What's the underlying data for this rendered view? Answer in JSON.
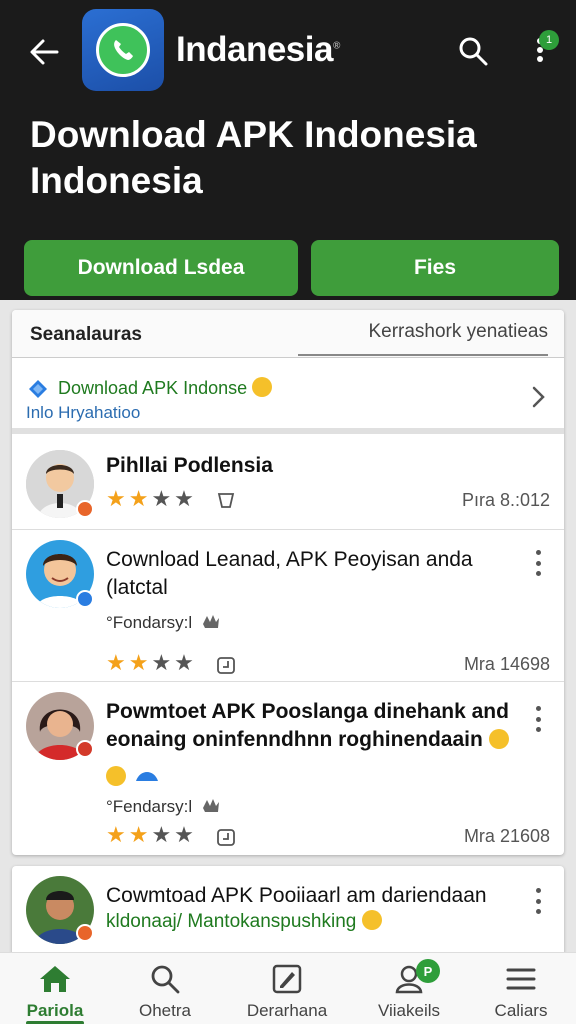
{
  "header": {
    "app_name": "Indanesia",
    "title": "Download APK Indonesia Indonesia",
    "notification_count": "1",
    "primary_button": "Download Lsdea",
    "secondary_button": "Fies"
  },
  "tabs": {
    "left": "Seanalauras",
    "right": "Kerrashork yenatieas"
  },
  "promo": {
    "title": "Download APK Indonse",
    "subtitle": "Inlo Hryahatioo"
  },
  "items": [
    {
      "title": "Pihllai Podlensia",
      "rating": 2,
      "meta": "Pıra  8.:012"
    },
    {
      "title": "Cownload Leanad, APK Peoyisan anda (latctal",
      "sub": "°Fondarsy:l",
      "rating": 2,
      "meta": "Mra  14698"
    },
    {
      "title": "Powmtoet APK Pooslanga dinehank and eonaing oninfenndhnn roghinendaain",
      "sub": "°Fendarsy:l",
      "rating": 2,
      "meta": "Mra  21608"
    },
    {
      "title": "Cowmtoad APK Pooiiaarl am dariendaan",
      "sub_green": "kldonaaj/ Mantokanspushking"
    }
  ],
  "nav": [
    {
      "label": "Pariola"
    },
    {
      "label": "Ohetra"
    },
    {
      "label": "Derarhana"
    },
    {
      "label": "Viiakeils",
      "badge": "P"
    },
    {
      "label": "Caliars"
    }
  ],
  "colors": {
    "accent_green": "#3f9d3b",
    "header_bg": "#1b1b1b",
    "star": "#f4a11a",
    "link_blue": "#2b6cb0"
  }
}
